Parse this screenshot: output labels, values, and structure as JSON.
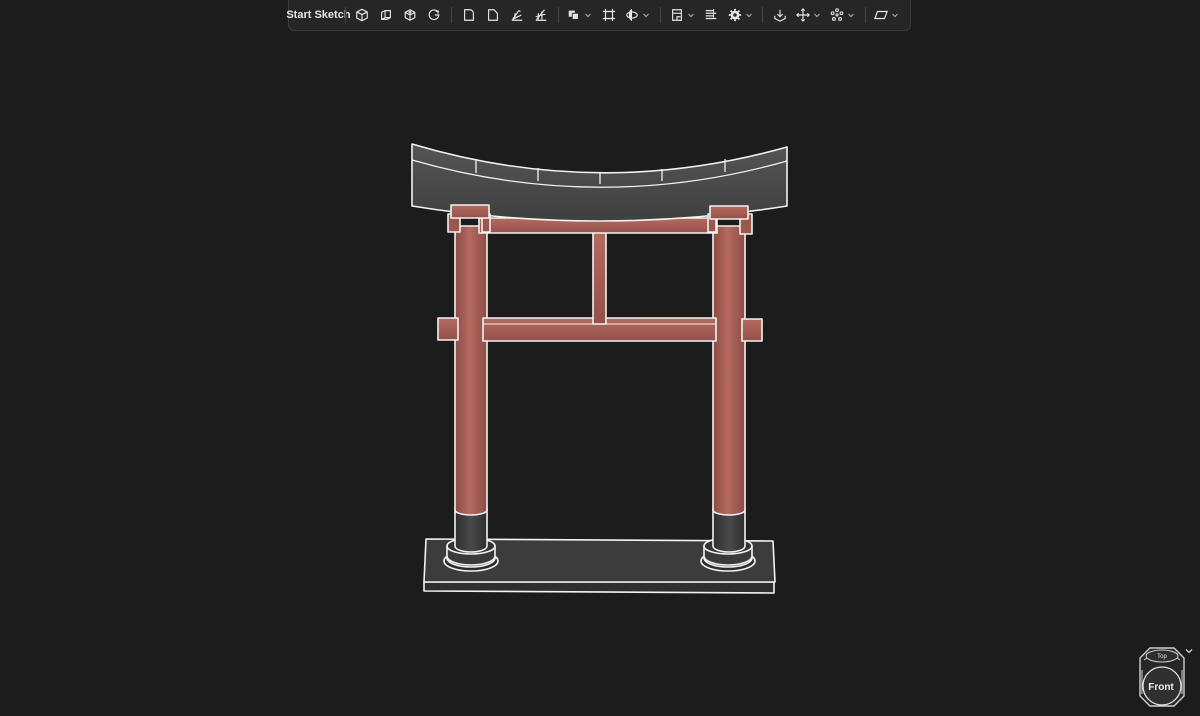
{
  "toolbar": {
    "start_sketch": {
      "label": "Start Sketch",
      "icon": "pencil-ruler-icon"
    },
    "groups": [
      [
        "extrude-icon",
        "revolve-icon",
        "loft-icon",
        "sweep-icon"
      ],
      [
        "fillet-icon",
        "chamfer-icon",
        "shell-icon",
        "draft-icon"
      ],
      [
        "boolean-icon",
        "split-icon",
        "helix-icon"
      ],
      [
        "plane-icon",
        "pattern-icon",
        "gear-icon"
      ],
      [
        "import-icon",
        "move-icon",
        "circular-pattern-icon"
      ],
      [
        "parallelogram-icon"
      ]
    ]
  },
  "viewport": {
    "background": "#1c1c1c",
    "model_colors": {
      "wood": "#a95e54",
      "roof": "#4a4a4a",
      "base": "#3a3a3a",
      "edge": "#f2f2f2"
    }
  },
  "view_cube": {
    "top_label": "Top",
    "front_label": "Front"
  }
}
